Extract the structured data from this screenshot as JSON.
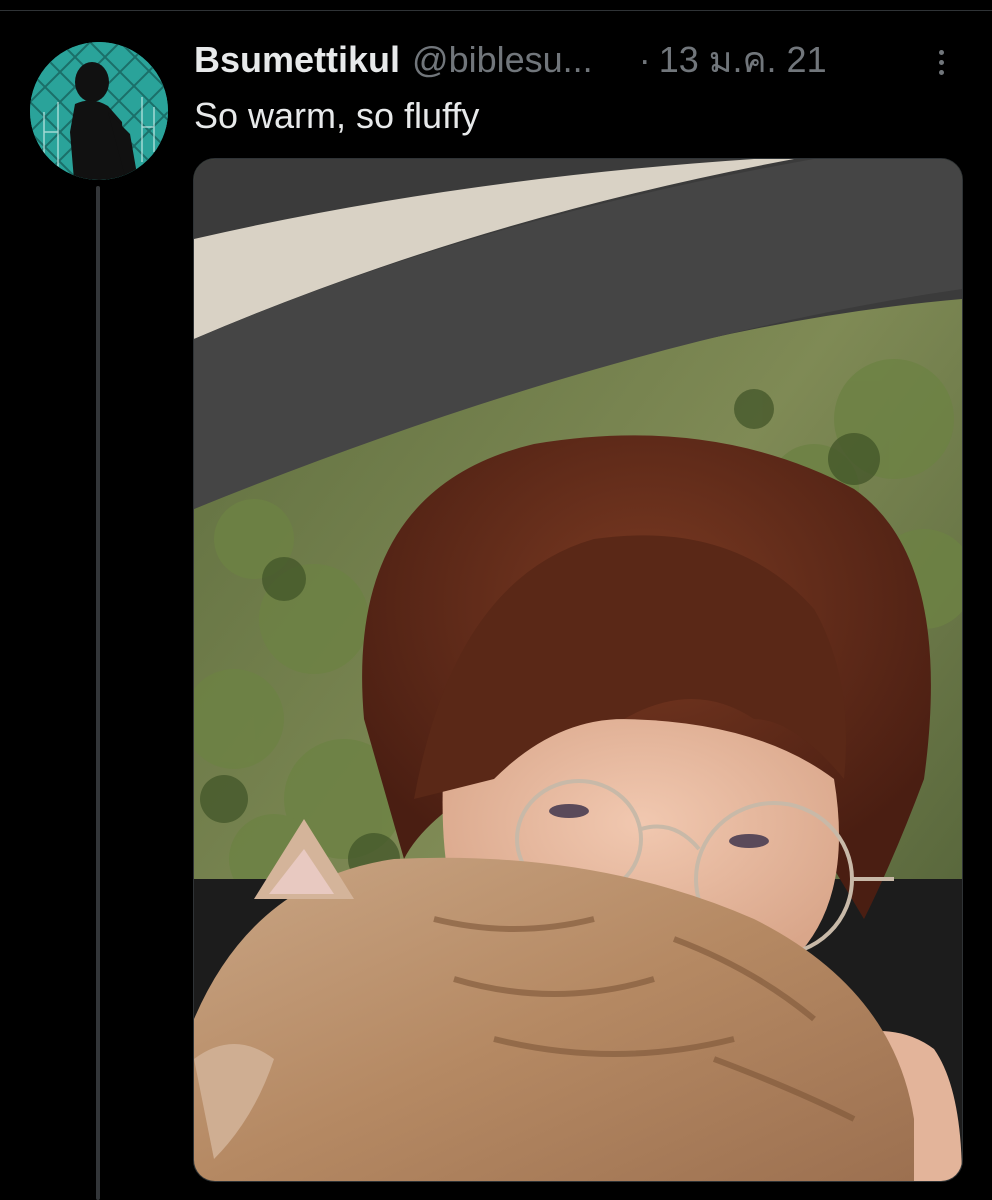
{
  "tweet": {
    "display_name": "Bsumettikul",
    "handle": "@biblesu...",
    "separator": "·",
    "date": "13 ม.ค. 21",
    "text": "So warm, so fluffy"
  },
  "icons": {
    "avatar": "avatar-silhouette",
    "more": "more-options-icon"
  },
  "colors": {
    "background": "#000000",
    "primary_text": "#e7e9ea",
    "secondary_text": "#71767b",
    "avatar_bg": "#2aa39a",
    "thread_line": "#333639"
  }
}
